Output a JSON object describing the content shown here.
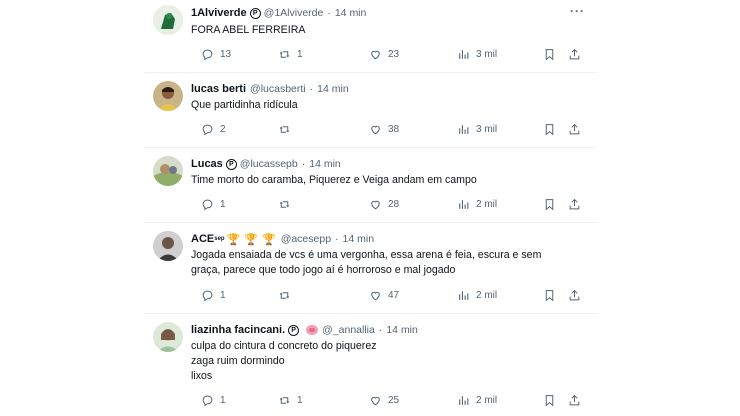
{
  "tweets": [
    {
      "name": "1Alviverde",
      "handle": "@1Alviverde",
      "time": "14 min",
      "text_lines": [
        "FORA ABEL FERREIRA"
      ],
      "replies": "13",
      "retweets": "1",
      "likes": "23",
      "views": "3 mil"
    },
    {
      "name": "lucas berti",
      "handle": "@lucasberti",
      "time": "14 min",
      "text_lines": [
        "Que partidinha ridícula"
      ],
      "replies": "2",
      "retweets": "",
      "likes": "38",
      "views": "3 mil"
    },
    {
      "name": "Lucas",
      "handle": "@lucassepb",
      "time": "14 min",
      "text_lines": [
        "Time morto do caramba, Piquerez e Veiga andam em campo"
      ],
      "replies": "1",
      "retweets": "",
      "likes": "28",
      "views": "2 mil"
    },
    {
      "name": "ACE",
      "name_sup": "sep",
      "handle": "@acesepp",
      "time": "14 min",
      "text_lines": [
        "Jogada ensaiada de vcs é uma vergonha, essa arena é feia, escura e sem",
        "graça, parece que todo jogo aí é horroroso e mal jogado"
      ],
      "replies": "1",
      "retweets": "",
      "likes": "47",
      "views": "2 mil"
    },
    {
      "name": "liazinha facincani.",
      "handle": "@_annallia",
      "time": "14 min",
      "text_lines": [
        "culpa do cintura d concreto do piquerez",
        "zaga ruim dormindo",
        "lixos"
      ],
      "replies": "1",
      "retweets": "1",
      "likes": "25",
      "views": "2 mil"
    }
  ],
  "icons": {
    "verified_badge": "P",
    "trophy": "🏆",
    "more": "···"
  },
  "colors": {
    "text": "#0f1419",
    "secondary": "#536471",
    "divider": "#eff3f4"
  }
}
